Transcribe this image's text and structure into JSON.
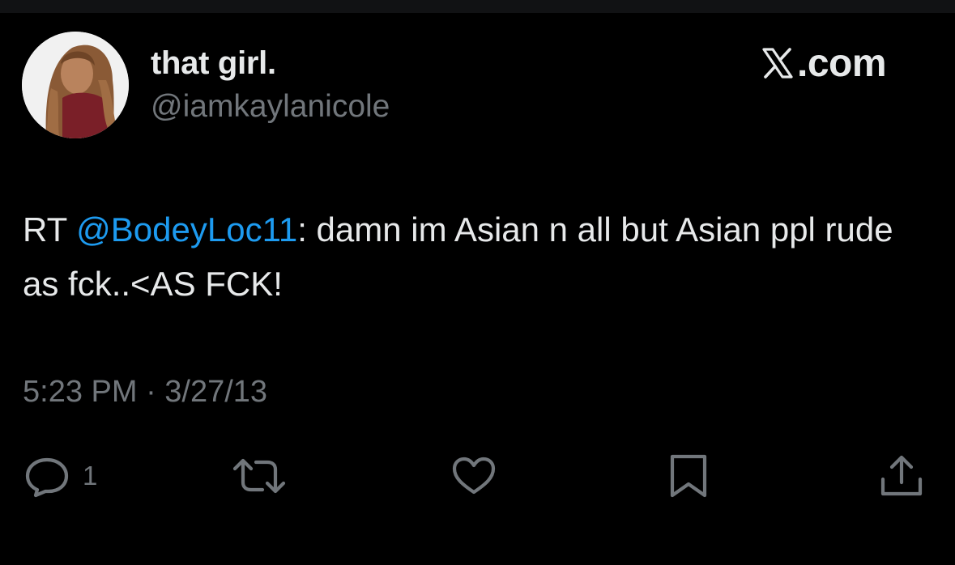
{
  "header": {
    "display_name": "that girl.",
    "handle": "@iamkaylanicole",
    "brand_text": ".com",
    "brand_logo_icon": "x-logo-icon"
  },
  "tweet": {
    "prefix": "RT ",
    "mention": "@BodeyLoc11",
    "body": ": damn im Asian n all but Asian ppl rude as fck..<AS FCK!",
    "timestamp": "5:23 PM · 3/27/13"
  },
  "actions": {
    "reply": {
      "icon": "reply-icon",
      "count": "1"
    },
    "retweet": {
      "icon": "retweet-icon"
    },
    "like": {
      "icon": "heart-icon"
    },
    "bookmark": {
      "icon": "bookmark-icon"
    },
    "share": {
      "icon": "share-icon"
    }
  },
  "colors": {
    "background": "#000000",
    "text": "#e7e9ea",
    "secondary": "#71767b",
    "mention": "#1d9bf0"
  }
}
